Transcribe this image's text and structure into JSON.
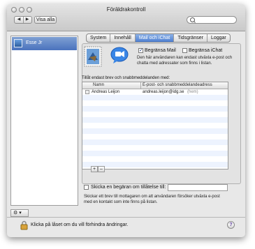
{
  "window": {
    "title": "Föräldrakontroll"
  },
  "toolbar": {
    "back_label": "◀",
    "forward_label": "▶",
    "show_all_label": "Visa alla",
    "search_value": ""
  },
  "sidebar": {
    "items": [
      {
        "label": "Esse Jr"
      }
    ],
    "gear_label": "⚙ ▾"
  },
  "tabs": [
    "System",
    "Innehåll",
    "Mail och iChat",
    "Tidsgränser",
    "Loggar"
  ],
  "selected_tab": "Mail och iChat",
  "mail_section": {
    "limit_mail_label": "Begränsa Mail",
    "limit_mail_checked": true,
    "limit_ichat_label": "Begränsa iChat",
    "limit_ichat_checked": false,
    "description": "Den här användaren kan endast utväxla e-post och chatta med adressater som finns i listan.",
    "allowed_label": "Tillåt endast brev och snabbmeddelanden med:",
    "columns": [
      "Namn",
      "E-post- och snabbmeddelandeadress"
    ],
    "rows": [
      {
        "name": "Andreas Leijon",
        "address": "andreas.leijon@idg.se",
        "note": "(hem)"
      }
    ],
    "add_label": "+",
    "remove_label": "–"
  },
  "permission": {
    "label": "Skicka en begäran om tillåtelse till:",
    "checked": false,
    "field_value": "",
    "description": "Skickar ett brev till mottagaren om att användaren försöker utväxla e-post med en kontakt som inte finns på listan."
  },
  "footer": {
    "lock_label": "Klicka på låset om du vill förhindra ändringar.",
    "help_label": "?"
  },
  "colors": {
    "selection": "#4a72bd",
    "tab_selected": "#5d8ad6",
    "window_bg": "#e8e8e8"
  }
}
